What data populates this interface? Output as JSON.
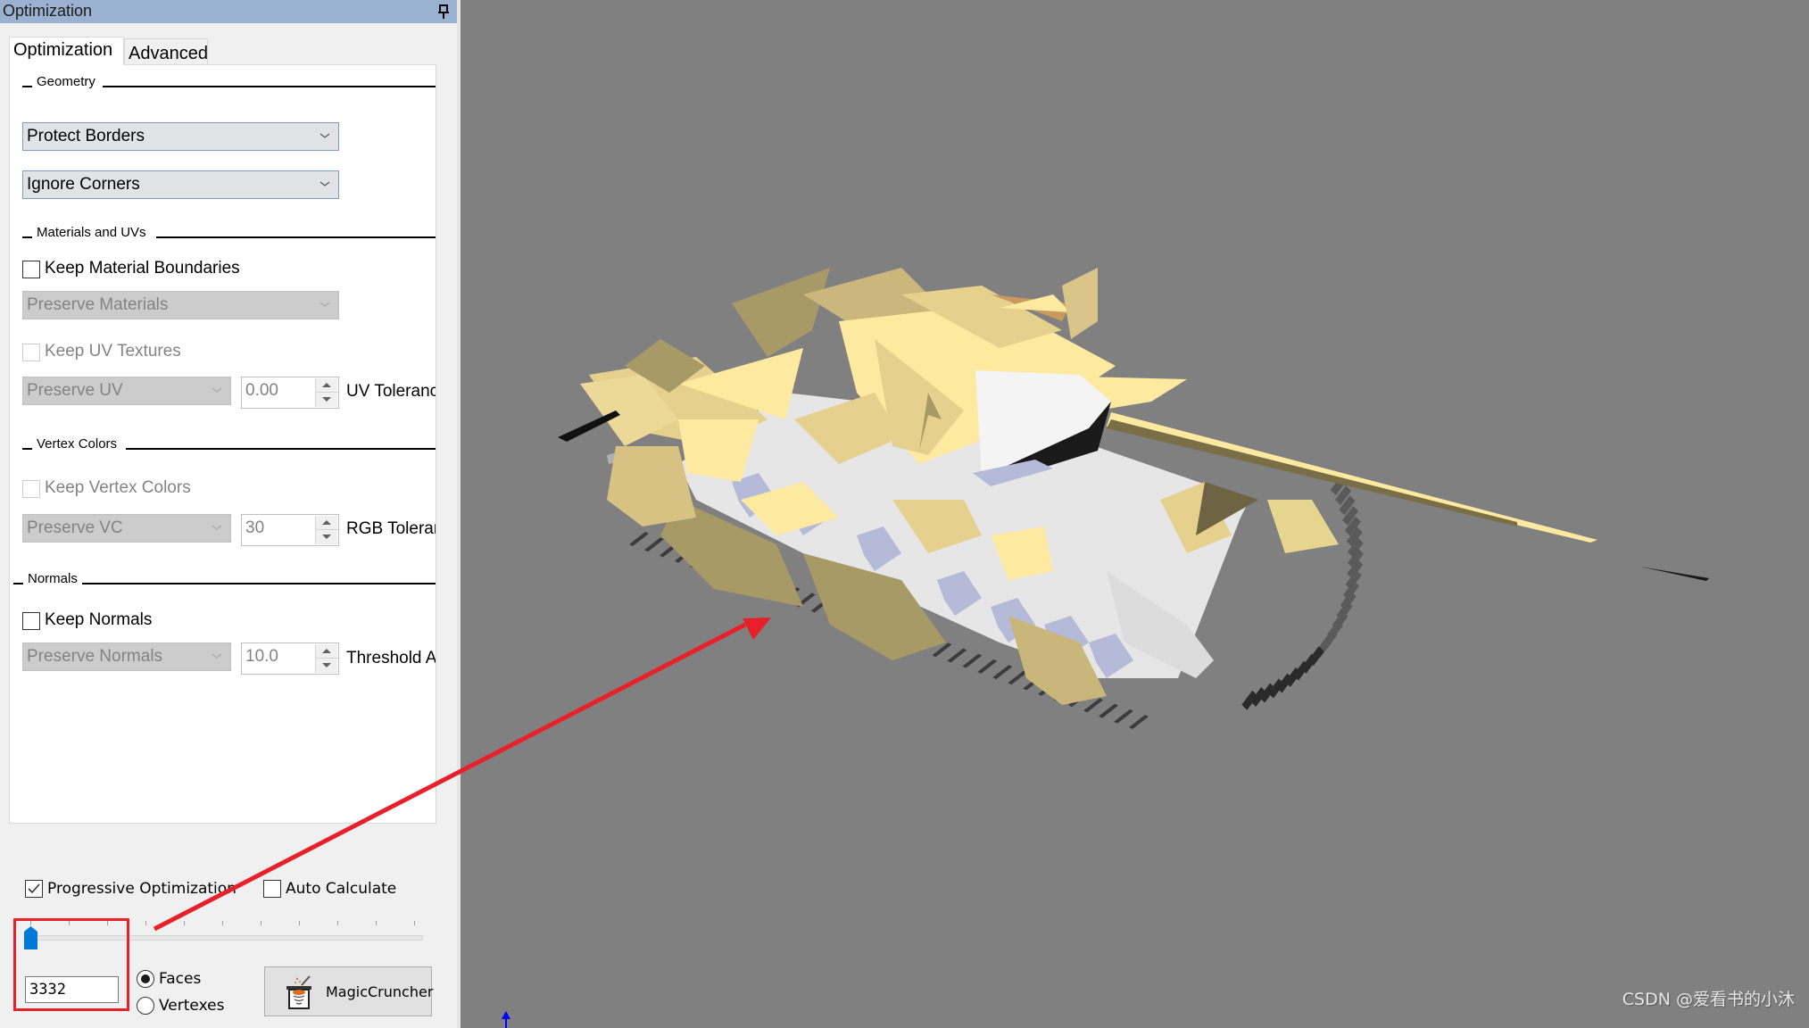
{
  "panel": {
    "title": "Optimization",
    "pin_icon": "pin-icon",
    "tabs": [
      {
        "label": "Optimization",
        "active": true
      },
      {
        "label": "Advanced",
        "active": false
      }
    ],
    "groups": {
      "geometry": {
        "title": "Geometry",
        "borders_combo": "Protect Borders",
        "corners_combo": "Ignore Corners"
      },
      "materials": {
        "title": "Materials and UVs",
        "keep_material_boundaries": {
          "label": "Keep Material Boundaries",
          "checked": false,
          "enabled": true
        },
        "materials_combo": "Preserve Materials",
        "keep_uv_textures": {
          "label": "Keep UV Textures",
          "checked": false,
          "enabled": false
        },
        "uv_combo": "Preserve UV",
        "uv_tolerance_value": "0.00",
        "uv_tolerance_label": "UV Tolerance"
      },
      "vertex_colors": {
        "title": "Vertex Colors",
        "keep_vertex_colors": {
          "label": "Keep Vertex Colors",
          "checked": false,
          "enabled": false
        },
        "vc_combo": "Preserve VC",
        "rgb_tolerance_value": "30",
        "rgb_tolerance_label": "RGB Tolerance"
      },
      "normals": {
        "title": "Normals",
        "keep_normals": {
          "label": "Keep Normals",
          "checked": false,
          "enabled": true
        },
        "normals_combo": "Preserve Normals",
        "threshold_value": "10.0",
        "threshold_label": "Threshold Angle"
      }
    },
    "bottom": {
      "progressive_optimization": {
        "label": "Progressive Optimization",
        "checked": true
      },
      "auto_calculate": {
        "label": "Auto Calculate",
        "checked": false
      },
      "slider_value_fraction": 0.0,
      "slider_ticks": 11,
      "count_value": "3332",
      "radio_faces": {
        "label": "Faces",
        "selected": true
      },
      "radio_vertexes": {
        "label": "Vertexes",
        "selected": false
      },
      "magic_button": "MagicCruncher"
    }
  },
  "viewport": {
    "background": "#808080",
    "model_colors": {
      "tan_light": "#fde9a0",
      "tan": "#e6d08e",
      "tan_dark": "#a89a66",
      "hull_white": "#e6e6e6",
      "steel_blue": "#b4bad8",
      "shadow": "#2a2a2a"
    },
    "annotation_color": "#e8202a",
    "axis_color": "#0000ff",
    "watermark": "CSDN @爱看书的小沐"
  }
}
